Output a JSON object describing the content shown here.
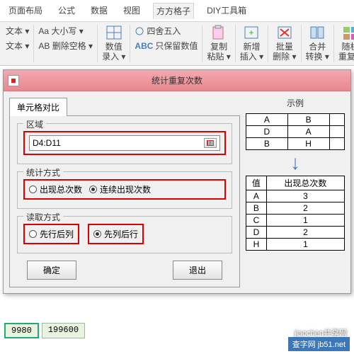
{
  "ribbon": {
    "tabs": [
      "页面布局",
      "公式",
      "数据",
      "视图",
      "方方格子",
      "DIY工具箱"
    ],
    "active_idx": 4,
    "grp1": {
      "a": "文本 ▾",
      "b": "文本 ▾",
      "c": "Aa 大小写 ▾",
      "d": "AB 删除空格 ▾"
    },
    "big1": "数值\n录入 ▾",
    "grp2": {
      "a": "四舍五入",
      "b": "只保留数值"
    },
    "bigs": [
      "复制\n粘贴 ▾",
      "新增\n插入 ▾",
      "批量\n删除 ▾",
      "合并\n转换 ▾",
      "随机\n重复 ▾"
    ]
  },
  "dialog": {
    "title": "统计重复次数",
    "tab": "单元格对比",
    "region": {
      "legend": "区域",
      "value": "D4:D11"
    },
    "stat": {
      "legend": "统计方式",
      "opt1": "出现总次数",
      "opt2": "连续出现次数",
      "sel": 1
    },
    "read": {
      "legend": "读取方式",
      "opt1": "先行后列",
      "opt2": "先列后行",
      "sel": 1
    },
    "ok": "确定",
    "cancel": "退出"
  },
  "example": {
    "title": "示例",
    "t1": [
      [
        "A",
        "B"
      ],
      [
        "D",
        "A"
      ],
      [
        "B",
        "H"
      ]
    ],
    "t2h": [
      "值",
      "出现总次数"
    ],
    "t2": [
      [
        "A",
        "3"
      ],
      [
        "B",
        "2"
      ],
      [
        "C",
        "1"
      ],
      [
        "D",
        "2"
      ],
      [
        "H",
        "1"
      ]
    ]
  },
  "sheet": {
    "c1": "9980",
    "c2": "199600"
  },
  "wm": {
    "site": "查字网 jb51.net",
    "sub": "jiaochen共享网"
  }
}
